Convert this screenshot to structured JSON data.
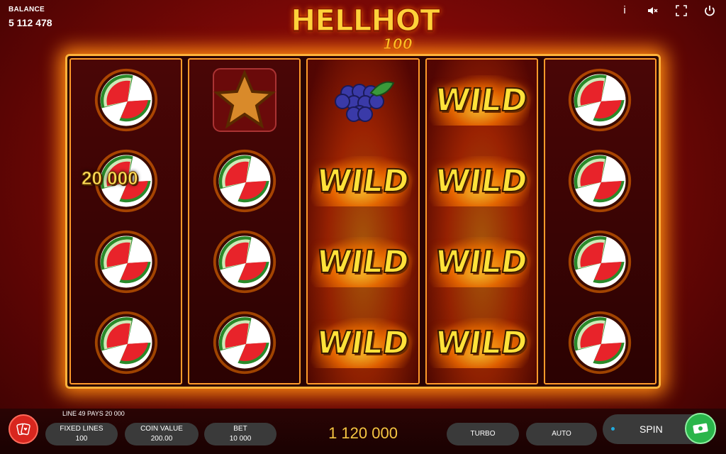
{
  "balance": {
    "label": "BALANCE",
    "value": "5 112 478"
  },
  "logo": {
    "title": "HELLHOT",
    "subtitle": "100"
  },
  "top_icons": [
    "info-icon",
    "mute-icon",
    "fullscreen-icon",
    "power-icon"
  ],
  "win_amount": "20 000",
  "reels": [
    [
      "watermelon",
      "watermelon",
      "watermelon",
      "watermelon"
    ],
    [
      "star",
      "watermelon",
      "watermelon",
      "watermelon"
    ],
    [
      "grapes",
      "wild",
      "wild",
      "wild"
    ],
    [
      "wild",
      "wild",
      "wild",
      "wild"
    ],
    [
      "watermelon",
      "watermelon",
      "watermelon",
      "watermelon"
    ]
  ],
  "wild_label": "WILD",
  "bottom": {
    "line_info": "LINE 49 PAYS 20 000",
    "fixed_lines": {
      "label": "FIXED LINES",
      "value": "100"
    },
    "coin_value": {
      "label": "COIN VALUE",
      "value": "200.00"
    },
    "bet": {
      "label": "BET",
      "value": "10 000"
    },
    "total_win": "1 120 000",
    "turbo": "TURBO",
    "auto": "AUTO",
    "spin": "SPIN"
  }
}
